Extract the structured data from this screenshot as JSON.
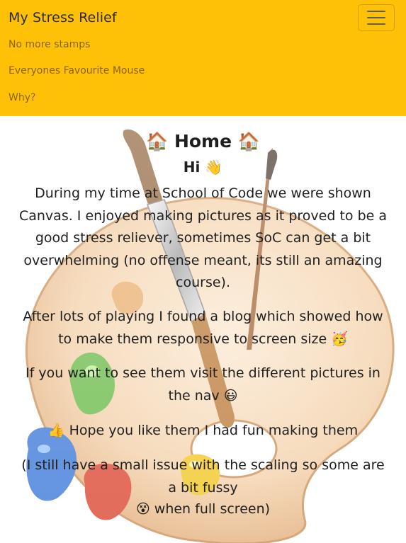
{
  "navbar": {
    "brand": "My Stress Relief",
    "links": [
      {
        "label": "No more stamps"
      },
      {
        "label": "Everyones Favourite Mouse"
      },
      {
        "label": "Why?"
      }
    ],
    "color": "#ffc107"
  },
  "main": {
    "title": "🏠 Home 🏠",
    "greeting": "Hi 👋",
    "paragraphs": [
      "During my time at School of Code we were shown Canvas. I enjoyed making pictures as it proved to be a good stress reliever, sometimes SoC can get a bit overwhelming (no offense meant, its still an amazing course).",
      "After lots of playing I found a blog which showed how to make them responsive to screen size 🥳",
      "If you want to see them visit the different pictures in the nav 😃",
      "👍 Hope you like them I had fun making them",
      "(I still have a small issue with the scaling so some are a bit fussy",
      "😵 when full screen)"
    ]
  },
  "icons": {
    "menu": "hamburger-menu-icon",
    "background": "paint-palette-and-brushes-illustration"
  }
}
